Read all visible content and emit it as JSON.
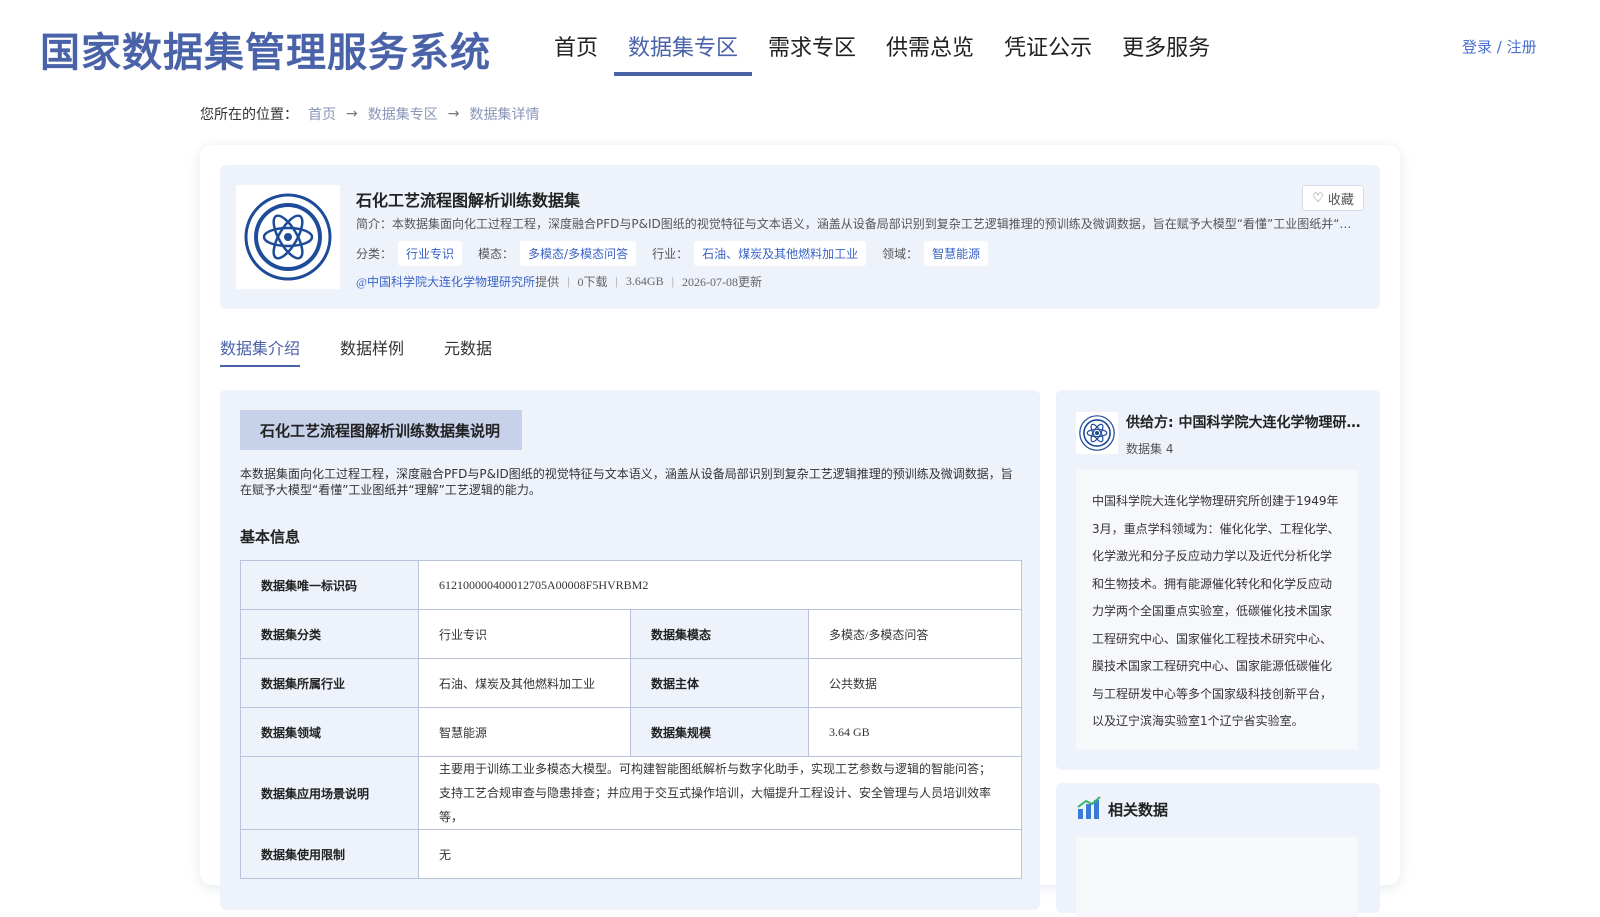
{
  "header": {
    "site_title": "国家数据集管理服务系统",
    "nav": [
      "首页",
      "数据集专区",
      "需求专区",
      "供需总览",
      "凭证公示",
      "更多服务"
    ],
    "active_nav": "数据集专区",
    "login": "登录",
    "login_sep": "/",
    "register": "注册",
    "brand_color": "#4a62a8"
  },
  "breadcrumb": {
    "prefix": "您所在的位置：",
    "items": [
      "首页",
      "数据集专区",
      "数据集详情"
    ]
  },
  "dataset": {
    "name": "石化工艺流程图解析训练数据集",
    "intro": "简介：本数据集面向化工过程工程，深度融合PFD与P&ID图纸的视觉特征与文本语义，涵盖从设备局部识别到复杂工艺逻辑推理的预训练及微调数据，旨在赋予大模型“看懂”工业图纸并“理解”工艺逻辑的能力。",
    "category_label": "分类：",
    "category": "行业专识",
    "modality_label": "模态：",
    "modality": "多模态/多模态问答",
    "industry_label": "行业：",
    "industry": "石油、煤炭及其他燃料加工业",
    "domain_label": "领域：",
    "domain": "智慧能源",
    "provider": "@中国科学院大连化学物理研究所",
    "provider_suffix": "提供",
    "downloads": "0下载",
    "size": "3.64GB",
    "updated": "2026-07-08更新",
    "favorite_label": "收藏",
    "favorite_icon": "heart-outline-icon"
  },
  "tabs": [
    "数据集介绍",
    "数据样例",
    "元数据"
  ],
  "active_tab": "数据集介绍",
  "description": {
    "title": "石化工艺流程图解析训练数据集说明",
    "text": "本数据集面向化工过程工程，深度融合PFD与P&ID图纸的视觉特征与文本语义，涵盖从设备局部识别到复杂工艺逻辑推理的预训练及微调数据，旨在赋予大模型“看懂”工业图纸并“理解”工艺逻辑的能力。",
    "basic_info_title": "基本信息"
  },
  "table": {
    "id_key": "数据集唯一标识码",
    "id_val": "612100000400012705A00008F5HVRBM2",
    "category_key": "数据集分类",
    "category_val": "行业专识",
    "modality_key": "数据集模态",
    "modality_val": "多模态/多模态问答",
    "industry_key": "数据集所属行业",
    "industry_val": "石油、煤炭及其他燃料加工业",
    "subject_key": "数据主体",
    "subject_val": "公共数据",
    "domain_key": "数据集领域",
    "domain_val": "智慧能源",
    "scale_key": "数据集规模",
    "scale_val": "3.64 GB",
    "scenario_key": "数据集应用场景说明",
    "scenario_val": "主要用于训练工业多模态大模型。可构建智能图纸解析与数字化助手，实现工艺参数与逻辑的智能问答；支持工艺合规审查与隐患排查；并应用于交互式操作培训，大幅提升工程设计、安全管理与人员培训效率等，",
    "restriction_key": "数据集使用限制",
    "restriction_val": "无"
  },
  "provider_card": {
    "name": "供给方: 中国科学院大连化学物理研究所",
    "count": "数据集 4",
    "description": "中国科学院大连化学物理研究所创建于1949年3月，重点学科领域为：催化化学、工程化学、化学激光和分子反应动力学以及近代分析化学和生物技术。拥有能源催化转化和化学反应动力学两个全国重点实验室，低碳催化技术国家工程研究中心、国家催化工程技术研究中心、膜技术国家工程研究中心、国家能源低碳催化与工程研发中心等多个国家级科技创新平台，以及辽宁滨海实验室1个辽宁省实验室。"
  },
  "related": {
    "title": "相关数据",
    "icon": "bar-chart-icon"
  }
}
